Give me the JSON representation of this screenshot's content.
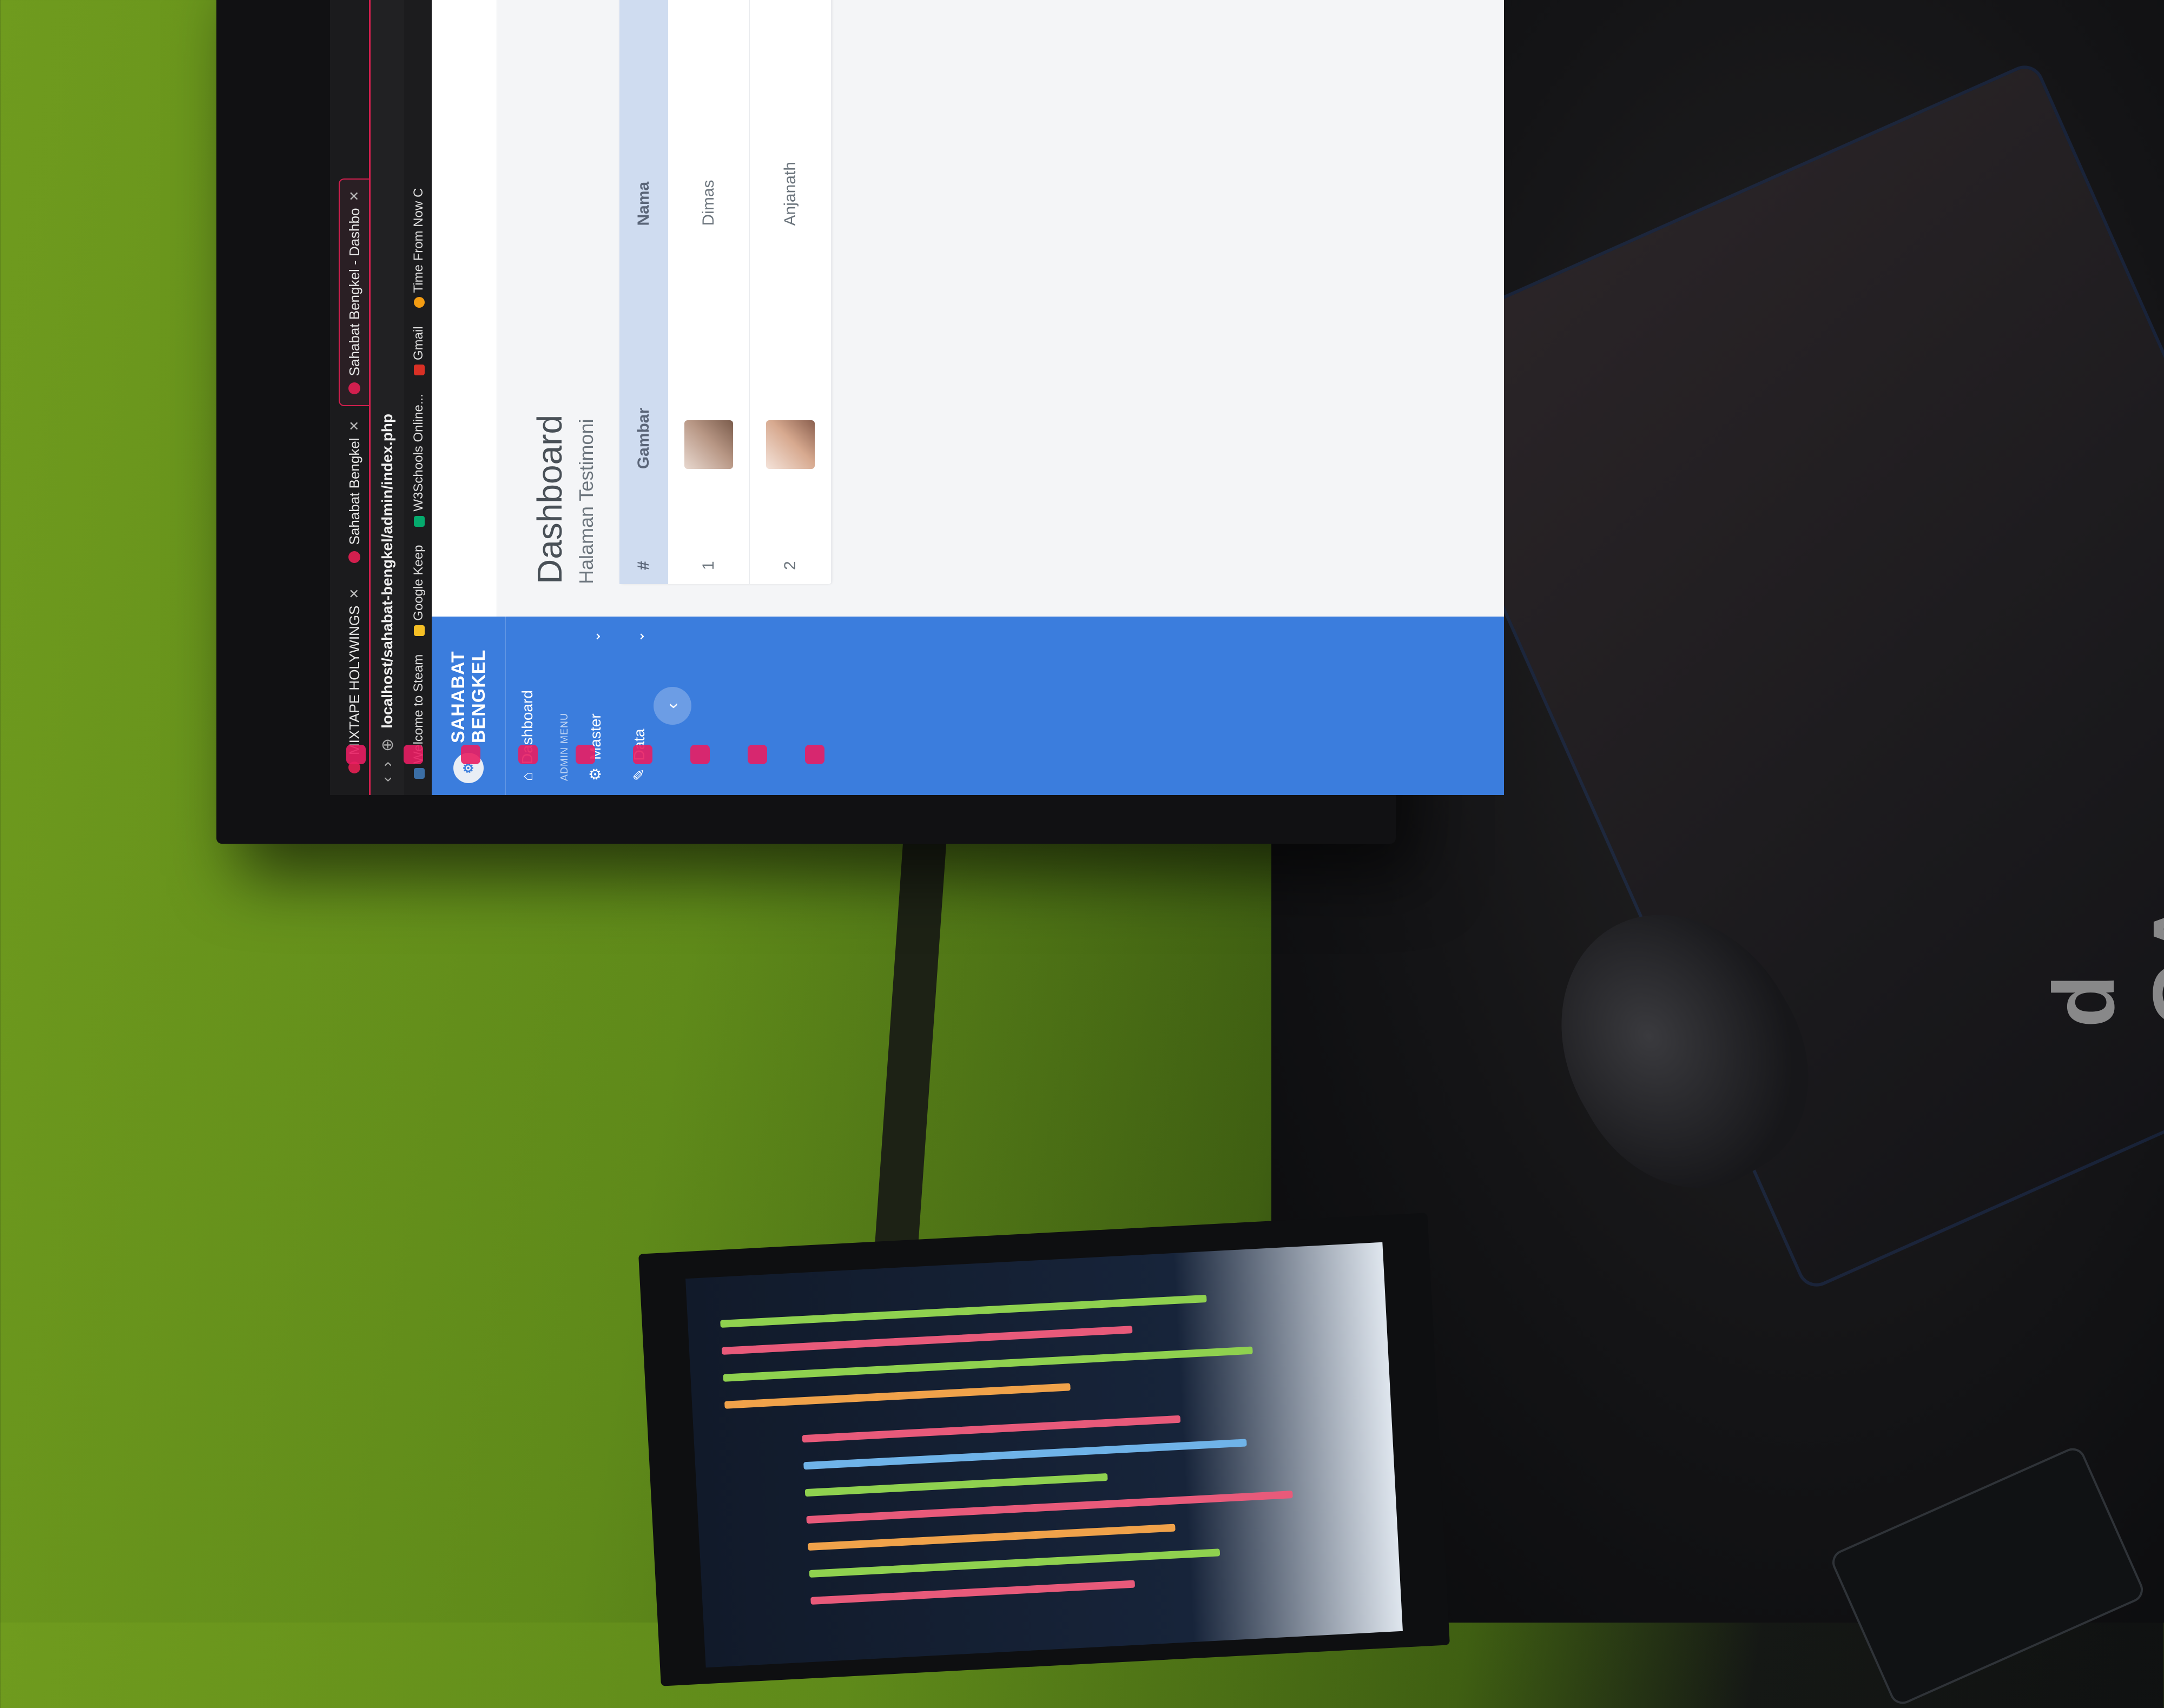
{
  "browser": {
    "tabs": [
      {
        "label": "MIXTAPE HOLYWINGS",
        "active": false
      },
      {
        "label": "Sahabat Bengkel",
        "active": false
      },
      {
        "label": "Sahabat Bengkel - Dashbo",
        "active": true
      }
    ],
    "url": "localhost/sahabat-bengkel/admin/index.php",
    "bookmarks": [
      "Welcome to Steam",
      "Google Keep",
      "W3Schools Online...",
      "Gmail",
      "Time From Now C"
    ]
  },
  "sidebar": {
    "brand_line1": "SAHABAT",
    "brand_line2": "BENGKEL",
    "dashboard_label": "Dashboard",
    "section_heading": "ADMIN MENU",
    "items": [
      {
        "label": "Master"
      },
      {
        "label": "Data"
      }
    ]
  },
  "main": {
    "title": "Dashboard",
    "subtitle": "Halaman Testimoni",
    "table": {
      "headers": [
        "#",
        "Gambar",
        "Nama"
      ],
      "rows": [
        {
          "no": "1",
          "nama": "Dimas"
        },
        {
          "no": "2",
          "nama": "Anjanath"
        }
      ]
    }
  },
  "desk": {
    "mousepad_logo": "d GA"
  },
  "colors": {
    "sidebar": "#3b7ddd",
    "accent": "#d21f4e",
    "desk": "#6f9b1e"
  }
}
